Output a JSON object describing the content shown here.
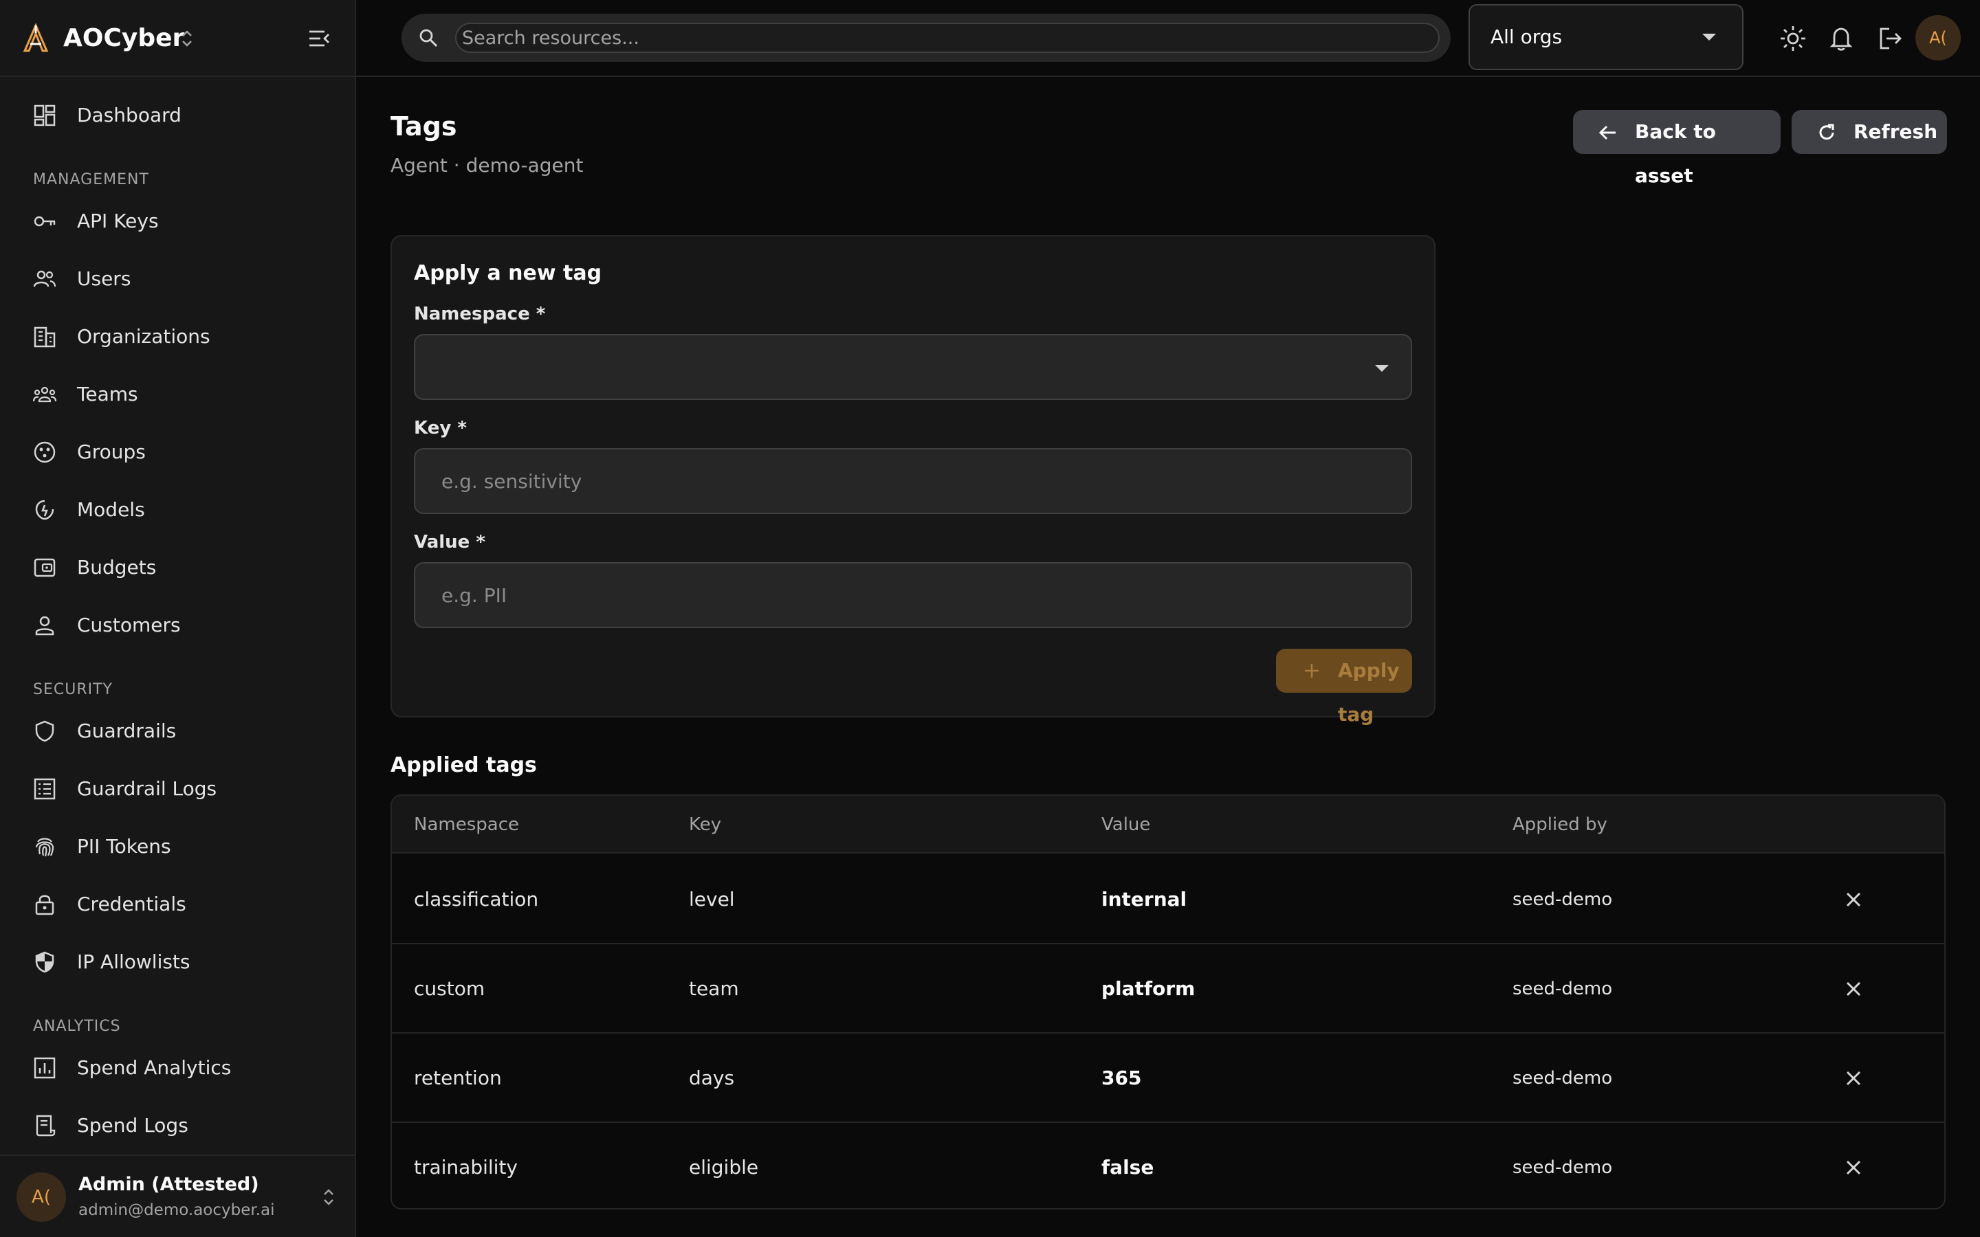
{
  "app": {
    "name": "AOCyber"
  },
  "sidebar": {
    "top": [
      {
        "label": "Dashboard",
        "icon": "dashboard-icon"
      }
    ],
    "sections": [
      {
        "title": "MANAGEMENT",
        "items": [
          {
            "label": "API Keys",
            "icon": "key-icon"
          },
          {
            "label": "Users",
            "icon": "users-icon"
          },
          {
            "label": "Organizations",
            "icon": "building-icon"
          },
          {
            "label": "Teams",
            "icon": "teams-icon"
          },
          {
            "label": "Groups",
            "icon": "groups-icon"
          },
          {
            "label": "Models",
            "icon": "model-icon"
          },
          {
            "label": "Budgets",
            "icon": "wallet-icon"
          },
          {
            "label": "Customers",
            "icon": "person-icon"
          }
        ]
      },
      {
        "title": "SECURITY",
        "items": [
          {
            "label": "Guardrails",
            "icon": "shield-icon"
          },
          {
            "label": "Guardrail Logs",
            "icon": "list-icon"
          },
          {
            "label": "PII Tokens",
            "icon": "fingerprint-icon"
          },
          {
            "label": "Credentials",
            "icon": "lock-icon"
          },
          {
            "label": "IP Allowlists",
            "icon": "shield-half-icon"
          }
        ]
      },
      {
        "title": "ANALYTICS",
        "items": [
          {
            "label": "Spend Analytics",
            "icon": "analytics-icon"
          },
          {
            "label": "Spend Logs",
            "icon": "receipt-icon"
          }
        ]
      }
    ],
    "user": {
      "initials": "A(",
      "name": "Admin (Attested)",
      "email": "admin@demo.aocyber.ai"
    }
  },
  "topbar": {
    "search_placeholder": "Search resources...",
    "org_selected": "All orgs",
    "avatar_initials": "A("
  },
  "page": {
    "title": "Tags",
    "subtitle": "Agent · demo-agent",
    "back_label": "Back to asset",
    "refresh_label": "Refresh"
  },
  "form": {
    "title": "Apply a new tag",
    "namespace_label": "Namespace *",
    "namespace_value": "",
    "key_label": "Key *",
    "key_placeholder": "e.g. sensitivity",
    "value_label": "Value *",
    "value_placeholder": "e.g. PII",
    "submit_label": "Apply tag"
  },
  "applied": {
    "title": "Applied tags",
    "columns": [
      "Namespace",
      "Key",
      "Value",
      "Applied by"
    ],
    "rows": [
      {
        "namespace": "classification",
        "key": "level",
        "value": "internal",
        "applied_by": "seed-demo"
      },
      {
        "namespace": "custom",
        "key": "team",
        "value": "platform",
        "applied_by": "seed-demo"
      },
      {
        "namespace": "retention",
        "key": "days",
        "value": "365",
        "applied_by": "seed-demo"
      },
      {
        "namespace": "trainability",
        "key": "eligible",
        "value": "false",
        "applied_by": "seed-demo"
      }
    ]
  },
  "colors": {
    "accent": "#e8a04a",
    "accent_muted": "#6b4a1e",
    "background": "#0a0a0a",
    "surface": "#171717"
  }
}
